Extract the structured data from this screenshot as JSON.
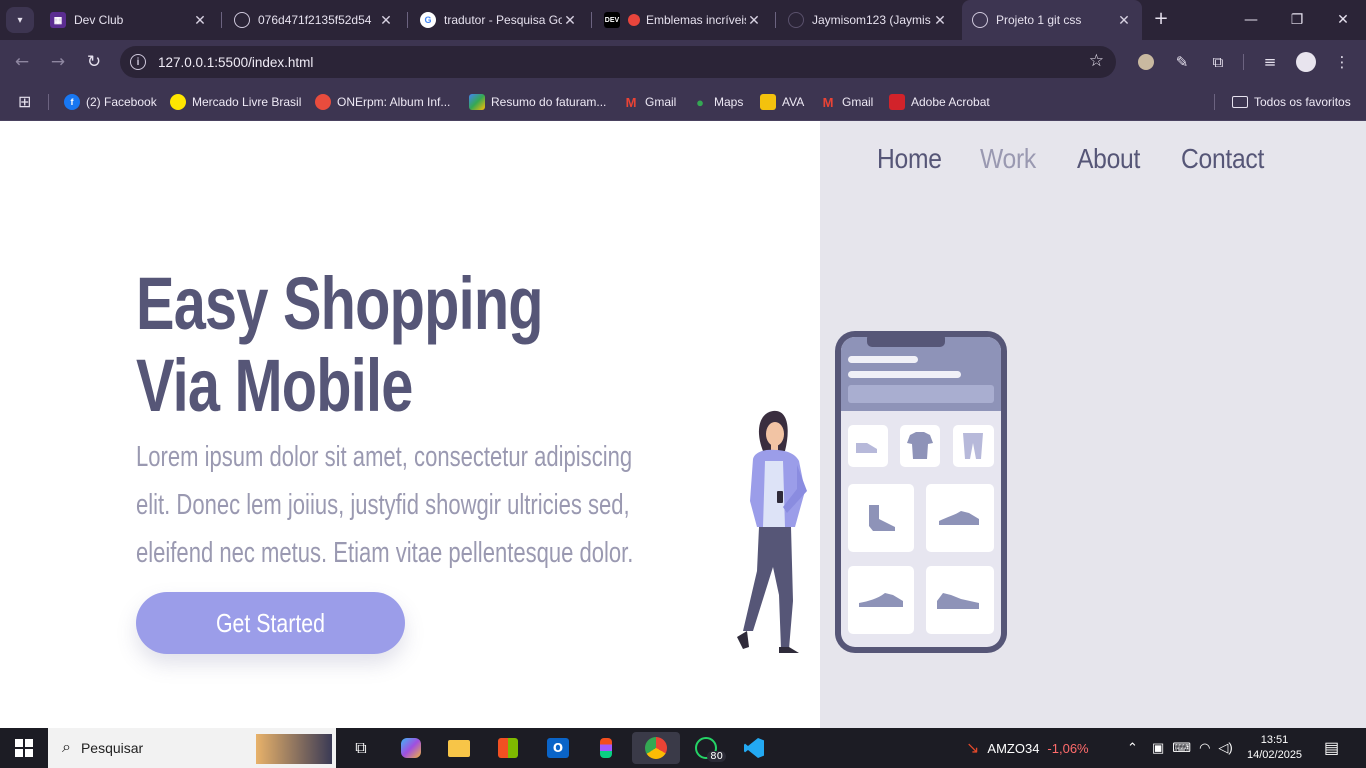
{
  "browser": {
    "tabs": [
      {
        "title": "Dev Club",
        "favicon": "devclub-icon"
      },
      {
        "title": "076d471f2135f52d54",
        "favicon": "globe-icon"
      },
      {
        "title": "tradutor - Pesquisa Go",
        "favicon": "google-icon"
      },
      {
        "title": "Emblemas incríveis",
        "favicon": "dev-icon"
      },
      {
        "title": "Jaymisom123 (Jaymis",
        "favicon": "github-icon"
      },
      {
        "title": "Projeto 1 git css",
        "favicon": "globe-icon"
      }
    ],
    "address": "127.0.0.1:5500/index.html",
    "bookmarks": [
      {
        "label": "(2) Facebook",
        "color": "#1877f2"
      },
      {
        "label": "Mercado Livre Brasil",
        "color": "#ffe600"
      },
      {
        "label": "ONErpm: Album Inf...",
        "color": "#e84c3d"
      },
      {
        "label": "Resumo do faturam...",
        "color": "#4285f4"
      },
      {
        "label": "Gmail",
        "color": "#ea4335"
      },
      {
        "label": "Maps",
        "color": "#34a853"
      },
      {
        "label": "AVA",
        "color": "#f4c20d"
      },
      {
        "label": "Gmail",
        "color": "#ea4335"
      },
      {
        "label": "Adobe Acrobat",
        "color": "#d2232a"
      }
    ],
    "all_bookmarks": "Todos os favoritos"
  },
  "site": {
    "nav": [
      "Home",
      "Work",
      "About",
      "Contact"
    ],
    "hero_line1": "Easy Shopping",
    "hero_line2": "Via Mobile",
    "desc_line1": "Lorem ipsum dolor sit amet, consectetur adipiscing",
    "desc_line2": "elit. Donec lem joiius, justyfid showgir ultricies sed,",
    "desc_line3": "eleifend nec metus. Etiam vitae pellentesque dolor.",
    "cta": "Get Started",
    "colors": {
      "primary": "#565677",
      "accent": "#9b9de9",
      "muted": "#9a99b1",
      "panel": "#e6e5ec"
    }
  },
  "taskbar": {
    "search_placeholder": "Pesquisar",
    "whatsapp_badge": "80",
    "stock_symbol": "AMZO34",
    "stock_change": "-1,06%",
    "time": "13:51",
    "date": "14/02/2025"
  }
}
